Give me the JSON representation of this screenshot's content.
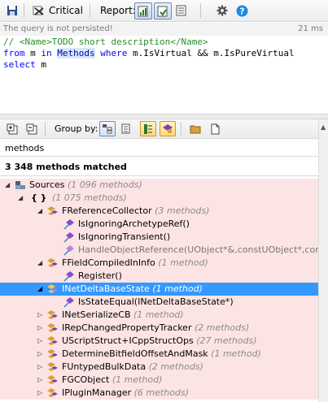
{
  "toolbar": {
    "critical_label": "Critical",
    "report_label": "Report:"
  },
  "status": {
    "message": "The query is not persisted!",
    "elapsed": "21 ms"
  },
  "editor": {
    "line1_comment": "// <Name>TODO short description</Name>",
    "line2_from": "from",
    "line2_m1": " m ",
    "line2_in": "in",
    "line2_sp": " ",
    "line2_methods": "Methods",
    "line2_where": " where ",
    "line2_rest": "m.IsVirtual && m.IsPureVirtual",
    "line3_select": "select",
    "line3_m": " m"
  },
  "results_toolbar": {
    "group_by_label": "Group by:"
  },
  "results": {
    "column_header": "methods",
    "matched_text": "3 348 methods matched",
    "tree": [
      {
        "label": "Sources",
        "count": "(1 096 methods)"
      },
      {
        "label": "{ }",
        "count": "(1 075 methods)"
      },
      {
        "label": "FReferenceCollector",
        "count": "(3 methods)"
      },
      {
        "label": "IsIgnoringArchetypeRef()",
        "count": ""
      },
      {
        "label": "IsIgnoringTransient()",
        "count": ""
      },
      {
        "label": "HandleObjectReference(UObject*&,constUObject*,constUO",
        "count": ""
      },
      {
        "label": "FFieldCompiledInInfo",
        "count": "(1 method)"
      },
      {
        "label": "Register()",
        "count": ""
      },
      {
        "label": "INetDeltaBaseState",
        "count": "(1 method)"
      },
      {
        "label": "IsStateEqual(INetDeltaBaseState*)",
        "count": ""
      },
      {
        "label": "INetSerializeCB",
        "count": "(1 method)"
      },
      {
        "label": "IRepChangedPropertyTracker",
        "count": "(2 methods)"
      },
      {
        "label": "UScriptStruct+ICppStructOps",
        "count": "(27 methods)"
      },
      {
        "label": "DetermineBitfieldOffsetAndMask",
        "count": "(1 method)"
      },
      {
        "label": "FUntypedBulkData",
        "count": "(2 methods)"
      },
      {
        "label": "FGCObject",
        "count": "(1 method)"
      },
      {
        "label": "IPluginManager",
        "count": "(6 methods)"
      }
    ]
  },
  "colors": {
    "selection": "#3399ff",
    "match_row": "#fde4e4",
    "comment": "#2b8c2b",
    "keyword": "#0000ff"
  }
}
